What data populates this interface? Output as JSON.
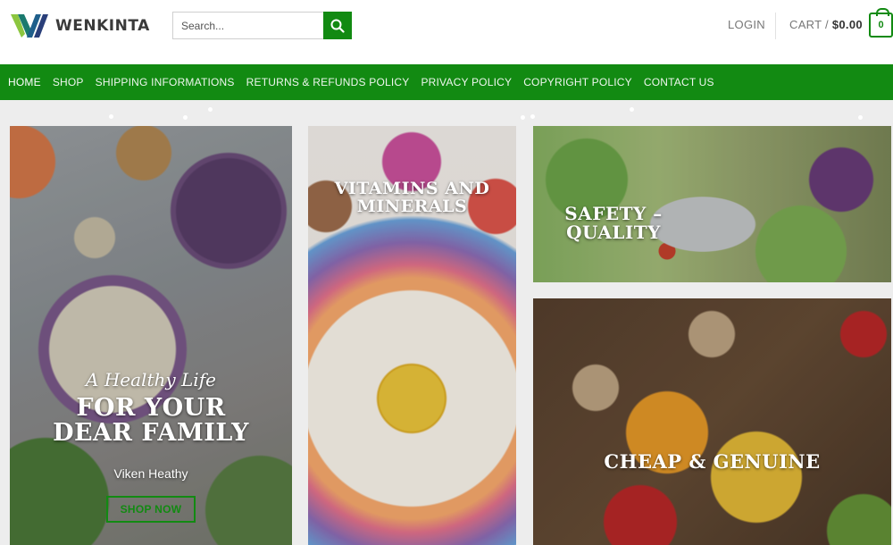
{
  "brand": {
    "name": "WENKINTA",
    "logo_icon": "wk-logo-icon",
    "accent": "#128a12"
  },
  "search": {
    "placeholder": "Search...",
    "icon": "search-icon"
  },
  "header": {
    "login_label": "LOGIN",
    "cart_label": "CART /",
    "cart_amount": "$0.00",
    "cart_count": "0"
  },
  "nav": {
    "items": [
      {
        "label": "HOME"
      },
      {
        "label": "SHOP"
      },
      {
        "label": "SHIPPING INFORMATIONS"
      },
      {
        "label": "RETURNS & REFUNDS POLICY"
      },
      {
        "label": "PRIVACY POLICY"
      },
      {
        "label": "COPYRIGHT POLICY"
      },
      {
        "label": "CONTACT US"
      }
    ]
  },
  "tiles": {
    "hero": {
      "script": "A Healthy Life",
      "title_line1": "FOR YOUR",
      "title_line2": "DEAR FAMILY",
      "subtitle": "Viken Heathy",
      "button": "SHOP NOW"
    },
    "vitamins": {
      "line1": "VITAMINS AND",
      "line2": "MINERALS"
    },
    "safety": {
      "line1": "SAFETY –",
      "line2": "QUALITY"
    },
    "cheap": {
      "title": "CHEAP & GENUINE"
    }
  }
}
